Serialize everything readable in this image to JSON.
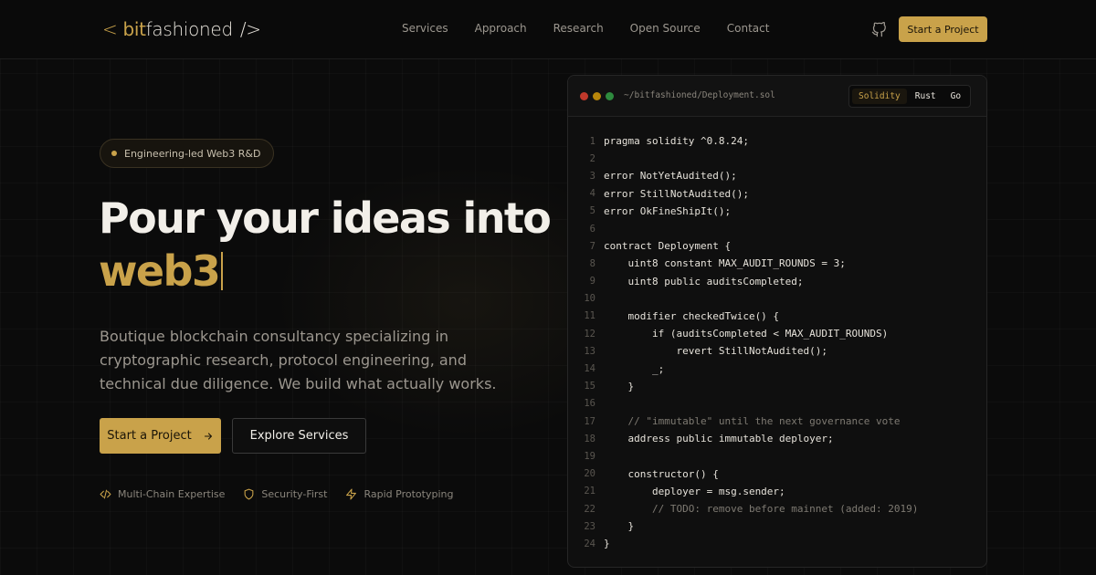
{
  "brand": {
    "lt": "<",
    "bit": "bit",
    "name": "fashioned",
    "suffix": "/>"
  },
  "nav": {
    "items": [
      "Services",
      "Approach",
      "Research",
      "Open Source",
      "Contact"
    ]
  },
  "header": {
    "cta_label": "Start a Project",
    "github_icon": "github-icon"
  },
  "hero": {
    "badge": "Engineering-led Web3 R&D",
    "title_line1": "Pour your ideas into",
    "title_accent": "web3",
    "subtitle": "Boutique blockchain consultancy specializing in cryptographic research, protocol engineering, and technical due diligence. We build what actually works.",
    "primary_cta": "Start a Project",
    "secondary_cta": "Explore Services",
    "features": [
      {
        "icon": "code-icon",
        "label": "Multi-Chain Expertise"
      },
      {
        "icon": "shield-icon",
        "label": "Security-First"
      },
      {
        "icon": "bolt-icon",
        "label": "Rapid Prototyping"
      }
    ]
  },
  "code_window": {
    "path": "~/bitfashioned/Deployment.sol",
    "tabs": [
      "Solidity",
      "Rust",
      "Go"
    ],
    "active_tab": "Solidity",
    "lines": [
      {
        "n": "1",
        "text": "pragma solidity ^0.8.24;",
        "comment": false
      },
      {
        "n": "2",
        "text": "",
        "comment": false
      },
      {
        "n": "3",
        "text": "error NotYetAudited();",
        "comment": false
      },
      {
        "n": "4",
        "text": "error StillNotAudited();",
        "comment": false
      },
      {
        "n": "5",
        "text": "error OkFineShipIt();",
        "comment": false
      },
      {
        "n": "6",
        "text": "",
        "comment": false
      },
      {
        "n": "7",
        "text": "contract Deployment {",
        "comment": false
      },
      {
        "n": "8",
        "text": "    uint8 constant MAX_AUDIT_ROUNDS = 3;",
        "comment": false
      },
      {
        "n": "9",
        "text": "    uint8 public auditsCompleted;",
        "comment": false
      },
      {
        "n": "10",
        "text": "",
        "comment": false
      },
      {
        "n": "11",
        "text": "    modifier checkedTwice() {",
        "comment": false
      },
      {
        "n": "12",
        "text": "        if (auditsCompleted < MAX_AUDIT_ROUNDS)",
        "comment": false
      },
      {
        "n": "13",
        "text": "            revert StillNotAudited();",
        "comment": false
      },
      {
        "n": "14",
        "text": "        _;",
        "comment": false
      },
      {
        "n": "15",
        "text": "    }",
        "comment": false
      },
      {
        "n": "16",
        "text": "",
        "comment": false
      },
      {
        "n": "17",
        "text": "    // \"immutable\" until the next governance vote",
        "comment": true
      },
      {
        "n": "18",
        "text": "    address public immutable deployer;",
        "comment": false
      },
      {
        "n": "19",
        "text": "",
        "comment": false
      },
      {
        "n": "20",
        "text": "    constructor() {",
        "comment": false
      },
      {
        "n": "21",
        "text": "        deployer = msg.sender;",
        "comment": false
      },
      {
        "n": "22",
        "text": "        // TODO: remove before mainnet (added: 2019)",
        "comment": true
      },
      {
        "n": "23",
        "text": "    }",
        "comment": false
      },
      {
        "n": "24",
        "text": "}",
        "comment": false
      }
    ]
  },
  "colors": {
    "accent": "#c9a24a",
    "background": "#0b0b0b",
    "dot_red": "#c0392b",
    "dot_yellow": "#b8860b",
    "dot_green": "#2e8b3e"
  }
}
